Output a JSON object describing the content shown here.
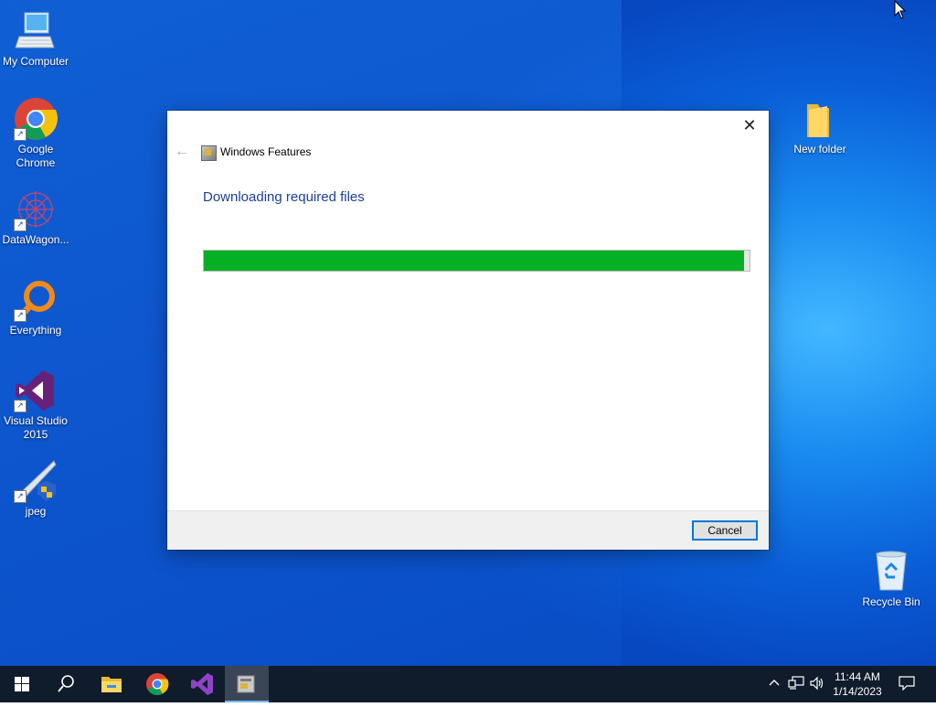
{
  "desktop": {
    "icons": [
      {
        "label": "My Computer"
      },
      {
        "label": "Google\nChrome"
      },
      {
        "label": "DataWagon..."
      },
      {
        "label": "Everything"
      },
      {
        "label": "Visual Studio\n2015"
      },
      {
        "label": "jpeg"
      },
      {
        "label": "New folder"
      },
      {
        "label": "Recycle Bin"
      }
    ]
  },
  "dialog": {
    "title": "Windows Features",
    "heading": "Downloading required files",
    "progress_percent": 99,
    "cancel_label": "Cancel",
    "close_glyph": "✕",
    "back_glyph": "←"
  },
  "taskbar": {
    "pinned": [
      "start-icon",
      "search-icon",
      "file-explorer-icon",
      "chrome-icon",
      "visual-studio-icon",
      "windows-features-icon"
    ],
    "clock_time": "11:44 AM",
    "clock_date": "1/14/2023"
  },
  "colors": {
    "progress": "#06b025",
    "heading": "#1c3f94",
    "taskbar": "#101b2b"
  }
}
